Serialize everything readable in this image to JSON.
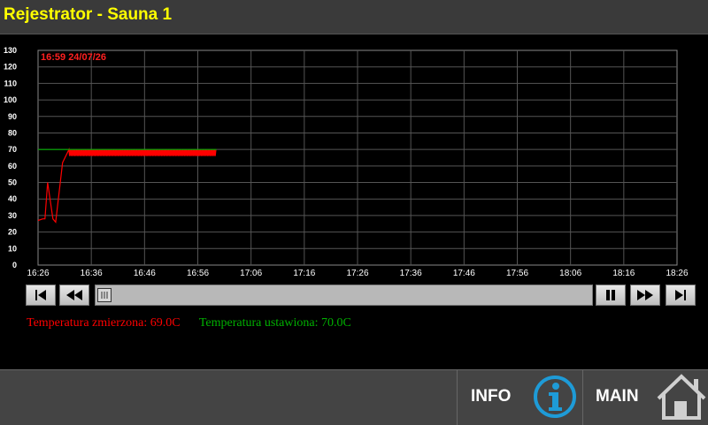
{
  "header": {
    "title": "Rejestrator - Sauna 1"
  },
  "chart_data": {
    "type": "line",
    "timestamp_label": "16:59  24/07/26",
    "y_ticks": [
      0,
      10,
      20,
      30,
      40,
      50,
      60,
      70,
      80,
      90,
      100,
      110,
      120,
      130
    ],
    "x_ticks": [
      "16:26",
      "16:36",
      "16:46",
      "16:56",
      "17:06",
      "17:16",
      "17:26",
      "17:36",
      "17:46",
      "17:56",
      "18:06",
      "18:16",
      "18:26"
    ],
    "ylim": [
      0,
      130
    ],
    "grid": true,
    "series": [
      {
        "name": "Temperatura zmierzona",
        "color": "#ff0000",
        "points": [
          [
            0,
            27
          ],
          [
            0.9,
            28
          ],
          [
            1.3,
            28
          ],
          [
            1.8,
            50
          ],
          [
            2.8,
            28
          ],
          [
            3.3,
            26
          ],
          [
            4.6,
            62
          ],
          [
            5.8,
            70
          ]
        ],
        "oscillation": {
          "from": 5.8,
          "to": 33.5,
          "min": 66,
          "max": 70
        }
      },
      {
        "name": "Temperatura ustawiona",
        "color": "#00b000",
        "points": [
          [
            0,
            70
          ],
          [
            33.5,
            70
          ]
        ]
      }
    ]
  },
  "scrollbar": {
    "position": 0
  },
  "legend": {
    "measured": "Temperatura zmierzona: 69.0C",
    "set": "Temperatura ustawiona: 70.0C",
    "measured_color": "#ff0000",
    "set_color": "#00b000"
  },
  "footer": {
    "info_label": "INFO",
    "main_label": "MAIN"
  }
}
